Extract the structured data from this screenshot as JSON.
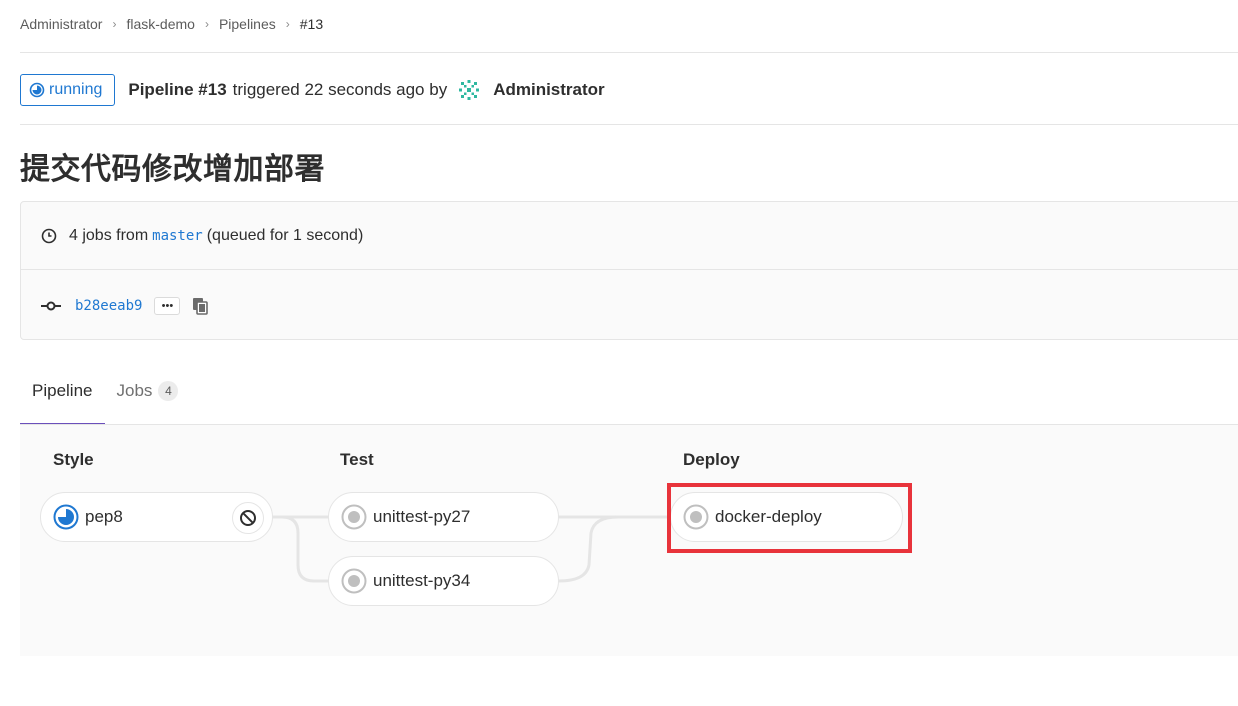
{
  "breadcrumb": [
    {
      "label": "Administrator"
    },
    {
      "label": "flask-demo"
    },
    {
      "label": "Pipelines"
    },
    {
      "label": "#13"
    }
  ],
  "header": {
    "status": "running",
    "pipeline_label": "Pipeline #13",
    "triggered_text": "triggered 22 seconds ago by",
    "user": "Administrator"
  },
  "commit": {
    "title": "提交代码修改增加部署"
  },
  "info": {
    "jobs_text": "4 jobs from",
    "branch": "master",
    "queued_text": "(queued for 1 second)",
    "sha": "b28eeab9",
    "ellipsis": "•••"
  },
  "tabs": [
    {
      "label": "Pipeline",
      "active": true
    },
    {
      "label": "Jobs",
      "count": "4",
      "active": false
    }
  ],
  "stages": [
    {
      "name": "Style",
      "jobs": [
        {
          "name": "pep8",
          "status": "running"
        }
      ]
    },
    {
      "name": "Test",
      "jobs": [
        {
          "name": "unittest-py27",
          "status": "created"
        },
        {
          "name": "unittest-py34",
          "status": "created"
        }
      ]
    },
    {
      "name": "Deploy",
      "jobs": [
        {
          "name": "docker-deploy",
          "status": "created"
        }
      ]
    }
  ],
  "colors": {
    "running": "#1f78d1",
    "created": "#bfbfbf",
    "highlight": "#e8333b",
    "active_tab": "#6b4fbb"
  }
}
